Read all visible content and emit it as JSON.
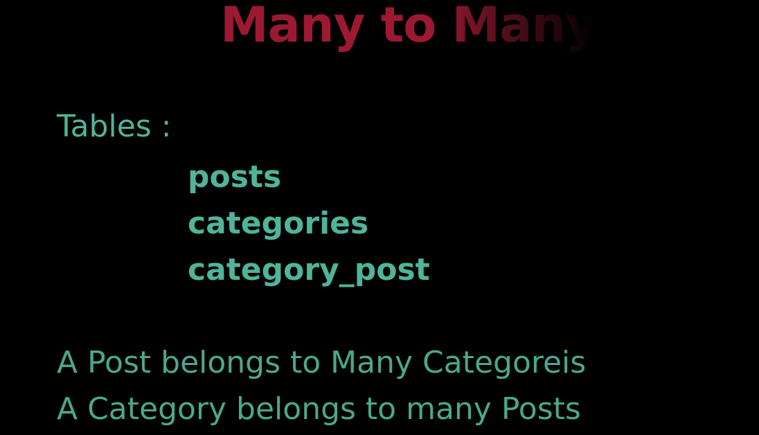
{
  "slide": {
    "title": "Many to Many",
    "tables_label": "Tables :",
    "tables": [
      "posts",
      "categories",
      "category_post"
    ],
    "relations": [
      "A Post belongs to Many Categoreis",
      "A Category belongs to many Posts"
    ]
  },
  "colors": {
    "background": "#000000",
    "title": "#9d1932",
    "text": "#4fb49a"
  }
}
